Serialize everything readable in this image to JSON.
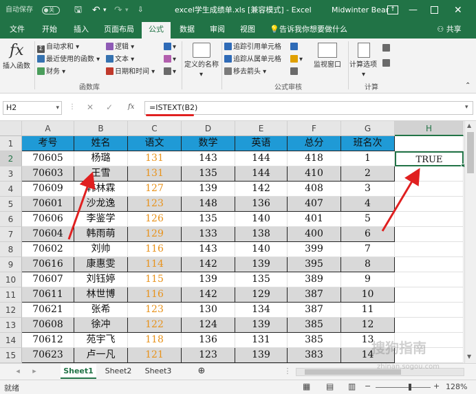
{
  "titlebar": {
    "autosave": "自动保存",
    "autosave_state": "关",
    "doc_title": "excel学生成绩单.xls [兼容模式] - Excel",
    "user": "Midwinter Bear"
  },
  "tabs": [
    "文件",
    "开始",
    "插入",
    "页面布局",
    "公式",
    "数据",
    "审阅",
    "视图"
  ],
  "tell_me": "告诉我你想要做什么",
  "share": "共享",
  "ribbon": {
    "insert_function": "插入函数",
    "autosum": "自动求和",
    "recent": "最近使用的函数",
    "finance": "财务",
    "logic": "逻辑",
    "text": "文本",
    "datetime": "日期和时间",
    "define_name": "定义的名称",
    "trace_precedents": "追踪引用单元格",
    "trace_dependents": "追踪从属单元格",
    "remove_arrows": "移去箭头",
    "watch_window": "监视窗口",
    "calc_options": "计算选项",
    "group_library": "函数库",
    "group_audit": "公式审核",
    "group_calc": "计算"
  },
  "formula_bar": {
    "name_box": "H2",
    "fx": "fx",
    "formula": "=ISTEXT(B2)"
  },
  "columns": [
    "A",
    "B",
    "C",
    "D",
    "E",
    "F",
    "G",
    "H"
  ],
  "selected_column": "H",
  "header_row": [
    "考号",
    "姓名",
    "语文",
    "数学",
    "英语",
    "总分",
    "班名次"
  ],
  "rows": [
    [
      "70605",
      "杨璐",
      "131",
      "143",
      "144",
      "418",
      "1"
    ],
    [
      "70603",
      "王雪",
      "131",
      "135",
      "144",
      "410",
      "2"
    ],
    [
      "70609",
      "韩林霖",
      "127",
      "139",
      "142",
      "408",
      "3"
    ],
    [
      "70601",
      "沙龙逸",
      "123",
      "148",
      "136",
      "407",
      "4"
    ],
    [
      "70606",
      "李鉴学",
      "126",
      "135",
      "140",
      "401",
      "5"
    ],
    [
      "70604",
      "韩雨萌",
      "129",
      "133",
      "138",
      "400",
      "6"
    ],
    [
      "70602",
      "刘帅",
      "116",
      "143",
      "140",
      "399",
      "7"
    ],
    [
      "70616",
      "康惠雯",
      "114",
      "142",
      "139",
      "395",
      "8"
    ],
    [
      "70607",
      "刘钰婷",
      "115",
      "139",
      "135",
      "389",
      "9"
    ],
    [
      "70611",
      "林世博",
      "116",
      "142",
      "129",
      "387",
      "10"
    ],
    [
      "70621",
      "张希",
      "123",
      "130",
      "134",
      "387",
      "11"
    ],
    [
      "70608",
      "徐冲",
      "122",
      "124",
      "139",
      "385",
      "12"
    ],
    [
      "70612",
      "苑宇飞",
      "118",
      "136",
      "131",
      "385",
      "13"
    ],
    [
      "70623",
      "卢一凡",
      "121",
      "123",
      "139",
      "383",
      "14"
    ]
  ],
  "row_numbers": [
    "1",
    "2",
    "3",
    "4",
    "5",
    "6",
    "7",
    "8",
    "9",
    "10",
    "11",
    "12",
    "13",
    "14",
    "15"
  ],
  "h2_value": "TRUE",
  "sheets": [
    "Sheet1",
    "Sheet2",
    "Sheet3"
  ],
  "status": {
    "ready": "就绪",
    "zoom": "128%"
  },
  "watermark": "搜狗指南",
  "watermark_url": "zhinan.sogou.com",
  "colors": {
    "excel_green": "#217346",
    "header_fill": "#1f9ad6",
    "orange": "#e8921a",
    "band": "#d9d9d9",
    "arrow": "#e02020"
  }
}
